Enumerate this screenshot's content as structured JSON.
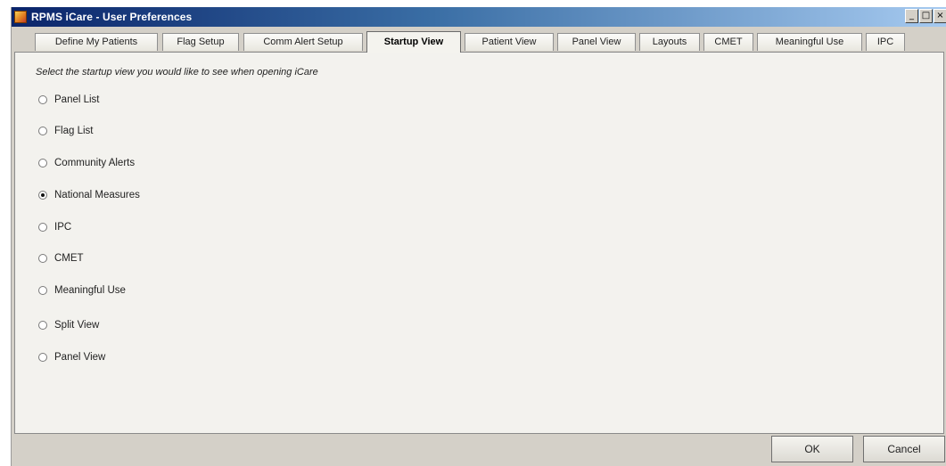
{
  "window": {
    "title": "RPMS iCare - User Preferences",
    "controls": {
      "minimize": "_",
      "maximize": "□",
      "close": "×"
    }
  },
  "tabs": [
    {
      "label": "Define My Patients",
      "active": false
    },
    {
      "label": "Flag Setup",
      "active": false
    },
    {
      "label": "Comm Alert Setup",
      "active": false
    },
    {
      "label": "Startup View",
      "active": true
    },
    {
      "label": "Patient View",
      "active": false
    },
    {
      "label": "Panel View",
      "active": false
    },
    {
      "label": "Layouts",
      "active": false
    },
    {
      "label": "CMET",
      "active": false
    },
    {
      "label": "Meaningful Use",
      "active": false
    },
    {
      "label": "IPC",
      "active": false
    }
  ],
  "startup": {
    "instructions": "Select the startup view you would like to see when opening iCare",
    "options": [
      {
        "label": "Panel List",
        "checked": false
      },
      {
        "label": "Flag List",
        "checked": false
      },
      {
        "label": "Community Alerts",
        "checked": false
      },
      {
        "label": "National Measures",
        "checked": true
      },
      {
        "label": "IPC",
        "checked": false
      },
      {
        "label": "CMET",
        "checked": false
      },
      {
        "label": "Meaningful Use",
        "checked": false
      },
      {
        "label": "Split View",
        "checked": false
      },
      {
        "label": "Panel View",
        "checked": false
      }
    ]
  },
  "buttons": {
    "ok": "OK",
    "cancel": "Cancel"
  },
  "colors": {
    "title_gradient_start": "#0a246a",
    "title_gradient_end": "#a6caf0",
    "panel_background": "#f3f2ee",
    "window_background": "#d4d0c8"
  }
}
